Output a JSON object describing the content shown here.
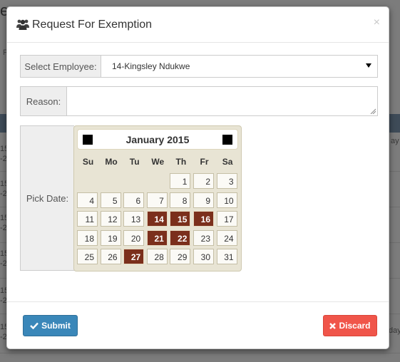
{
  "background": {
    "title_fragment": "e",
    "small_text": "F",
    "left_rows": [
      {
        "top": "15",
        "bottom": "-2"
      },
      {
        "top": "15",
        "bottom": "-2"
      },
      {
        "top": "15",
        "bottom": "-2"
      },
      {
        "top": "15",
        "bottom": "-2"
      },
      {
        "top": "15",
        "bottom": "-2"
      },
      {
        "top": "15",
        "bottom": "-2"
      },
      {
        "top": "15",
        "bottom": "-2"
      }
    ],
    "right_fragments": [
      "ay",
      "day"
    ]
  },
  "modal": {
    "title_icon": "users-icon",
    "title": "Request For Exemption",
    "close_label": "×"
  },
  "form": {
    "employee_label": "Select Employee:",
    "employee_value": "14-Kingsley Ndukwe",
    "reason_label": "Reason:",
    "reason_value": "",
    "date_label": "Pick Date:"
  },
  "calendar": {
    "month_label": "January 2015",
    "weekdays": [
      "Su",
      "Mo",
      "Tu",
      "We",
      "Th",
      "Fr",
      "Sa"
    ],
    "first_weekday_index": 4,
    "days_in_month": 31,
    "selected_days": [
      14,
      15,
      16,
      21,
      22,
      27
    ]
  },
  "buttons": {
    "submit": "Submit",
    "discard": "Discard"
  },
  "colors": {
    "selected_day": "#7b2f1c",
    "submit": "#3a87b9",
    "discard": "#f0554a"
  }
}
